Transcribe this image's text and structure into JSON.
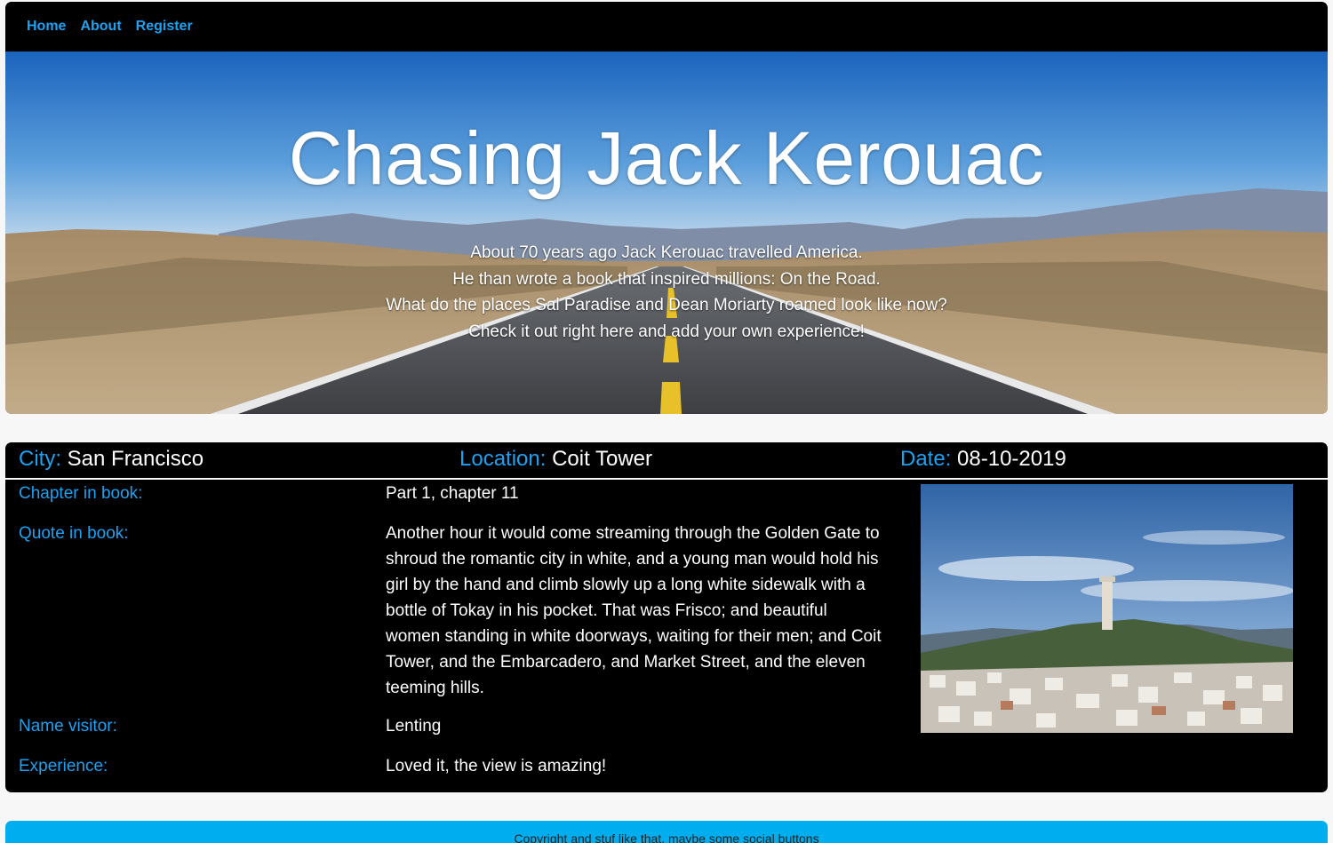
{
  "nav": {
    "items": [
      "Home",
      "About",
      "Register"
    ]
  },
  "hero": {
    "title": "Chasing Jack Kerouac",
    "lines": [
      "About 70 years ago Jack Kerouac travelled America.",
      "He than wrote a book that inspired millions: On the Road.",
      "What do the places Sal Paradise and Dean Moriarty roamed look like now?",
      "Check it out right here and add your own experience!"
    ]
  },
  "info": {
    "city_label": "City:",
    "city": "San Francisco",
    "location_label": "Location:",
    "location": "Coit Tower",
    "date_label": "Date:",
    "date": "08-10-2019"
  },
  "detail": {
    "chapter_label": "Chapter in book:",
    "chapter": "Part 1, chapter 11",
    "quote_label": "Quote in book:",
    "quote": "Another hour it would come streaming through the Golden Gate to shroud the romantic city in white, and a young man would hold his girl by the hand and climb slowly up a long white sidewalk with a bottle of Tokay in his pocket. That was Frisco; and beautiful women standing in white doorways, waiting for their men; and Coit Tower, and the Embarcadero, and Market Street, and the eleven teeming hills.",
    "visitor_label": "Name visitor:",
    "visitor": "Lenting",
    "experience_label": "Experience:",
    "experience": "Loved it, the view is amazing!"
  },
  "footer": {
    "text": "Copyright and stuf like that, maybe some social buttons"
  },
  "colors": {
    "accent": "#1da1f2",
    "footer": "#00aeef",
    "panel": "#000000"
  }
}
